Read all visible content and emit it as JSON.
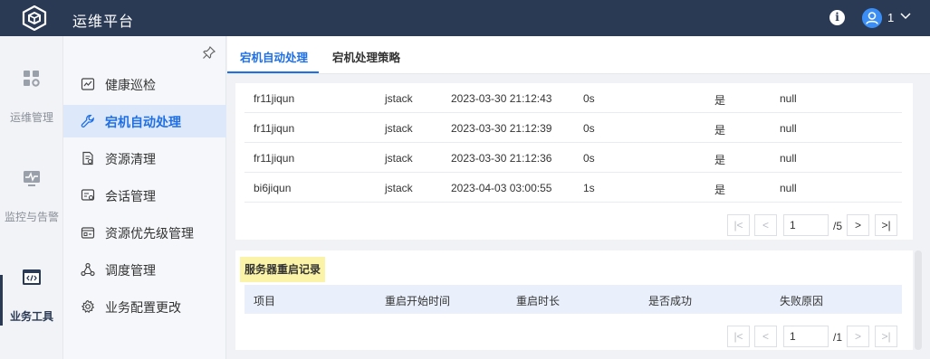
{
  "app": {
    "title": "运维平台"
  },
  "header": {
    "user_name": "1",
    "icons": [
      "logo-icon",
      "info-icon",
      "user-avatar-icon",
      "chevron-down-icon"
    ]
  },
  "rail": {
    "items": [
      {
        "label": "运维管理",
        "icon": "grid-settings-icon"
      },
      {
        "label": "监控与告警",
        "icon": "monitor-icon"
      },
      {
        "label": "业务工具",
        "icon": "code-window-icon",
        "active": true
      }
    ]
  },
  "submenu": {
    "items": [
      {
        "label": "健康巡检",
        "icon": "chart-box-icon"
      },
      {
        "label": "宕机自动处理",
        "icon": "wrench-icon",
        "active": true
      },
      {
        "label": "资源清理",
        "icon": "doc-clean-icon"
      },
      {
        "label": "会话管理",
        "icon": "session-icon"
      },
      {
        "label": "资源优先级管理",
        "icon": "priority-icon"
      },
      {
        "label": "调度管理",
        "icon": "schedule-nodes-icon"
      },
      {
        "label": "业务配置更改",
        "icon": "config-gear-icon"
      }
    ]
  },
  "tabs": [
    {
      "label": "宕机自动处理",
      "active": true
    },
    {
      "label": "宕机处理策略"
    }
  ],
  "top_table": {
    "rows": [
      [
        "fr11jiqun",
        "jstack",
        "2023-03-30 21:12:43",
        "0s",
        "是",
        "null"
      ],
      [
        "fr11jiqun",
        "jstack",
        "2023-03-30 21:12:39",
        "0s",
        "是",
        "null"
      ],
      [
        "fr11jiqun",
        "jstack",
        "2023-03-30 21:12:36",
        "0s",
        "是",
        "null"
      ],
      [
        "bi6jiqun",
        "jstack",
        "2023-04-03 03:00:55",
        "1s",
        "是",
        "null"
      ]
    ],
    "pagination": {
      "first": "|<",
      "prev": "<",
      "page": "1",
      "total": "/5",
      "next": ">",
      "last": ">|"
    }
  },
  "restart_section": {
    "title": "服务器重启记录",
    "headers": [
      "项目",
      "重启开始时间",
      "重启时长",
      "是否成功",
      "失败原因"
    ],
    "pagination": {
      "first": "|<",
      "prev": "<",
      "page": "1",
      "total": "/1",
      "next": ">",
      "last": ">|"
    }
  }
}
